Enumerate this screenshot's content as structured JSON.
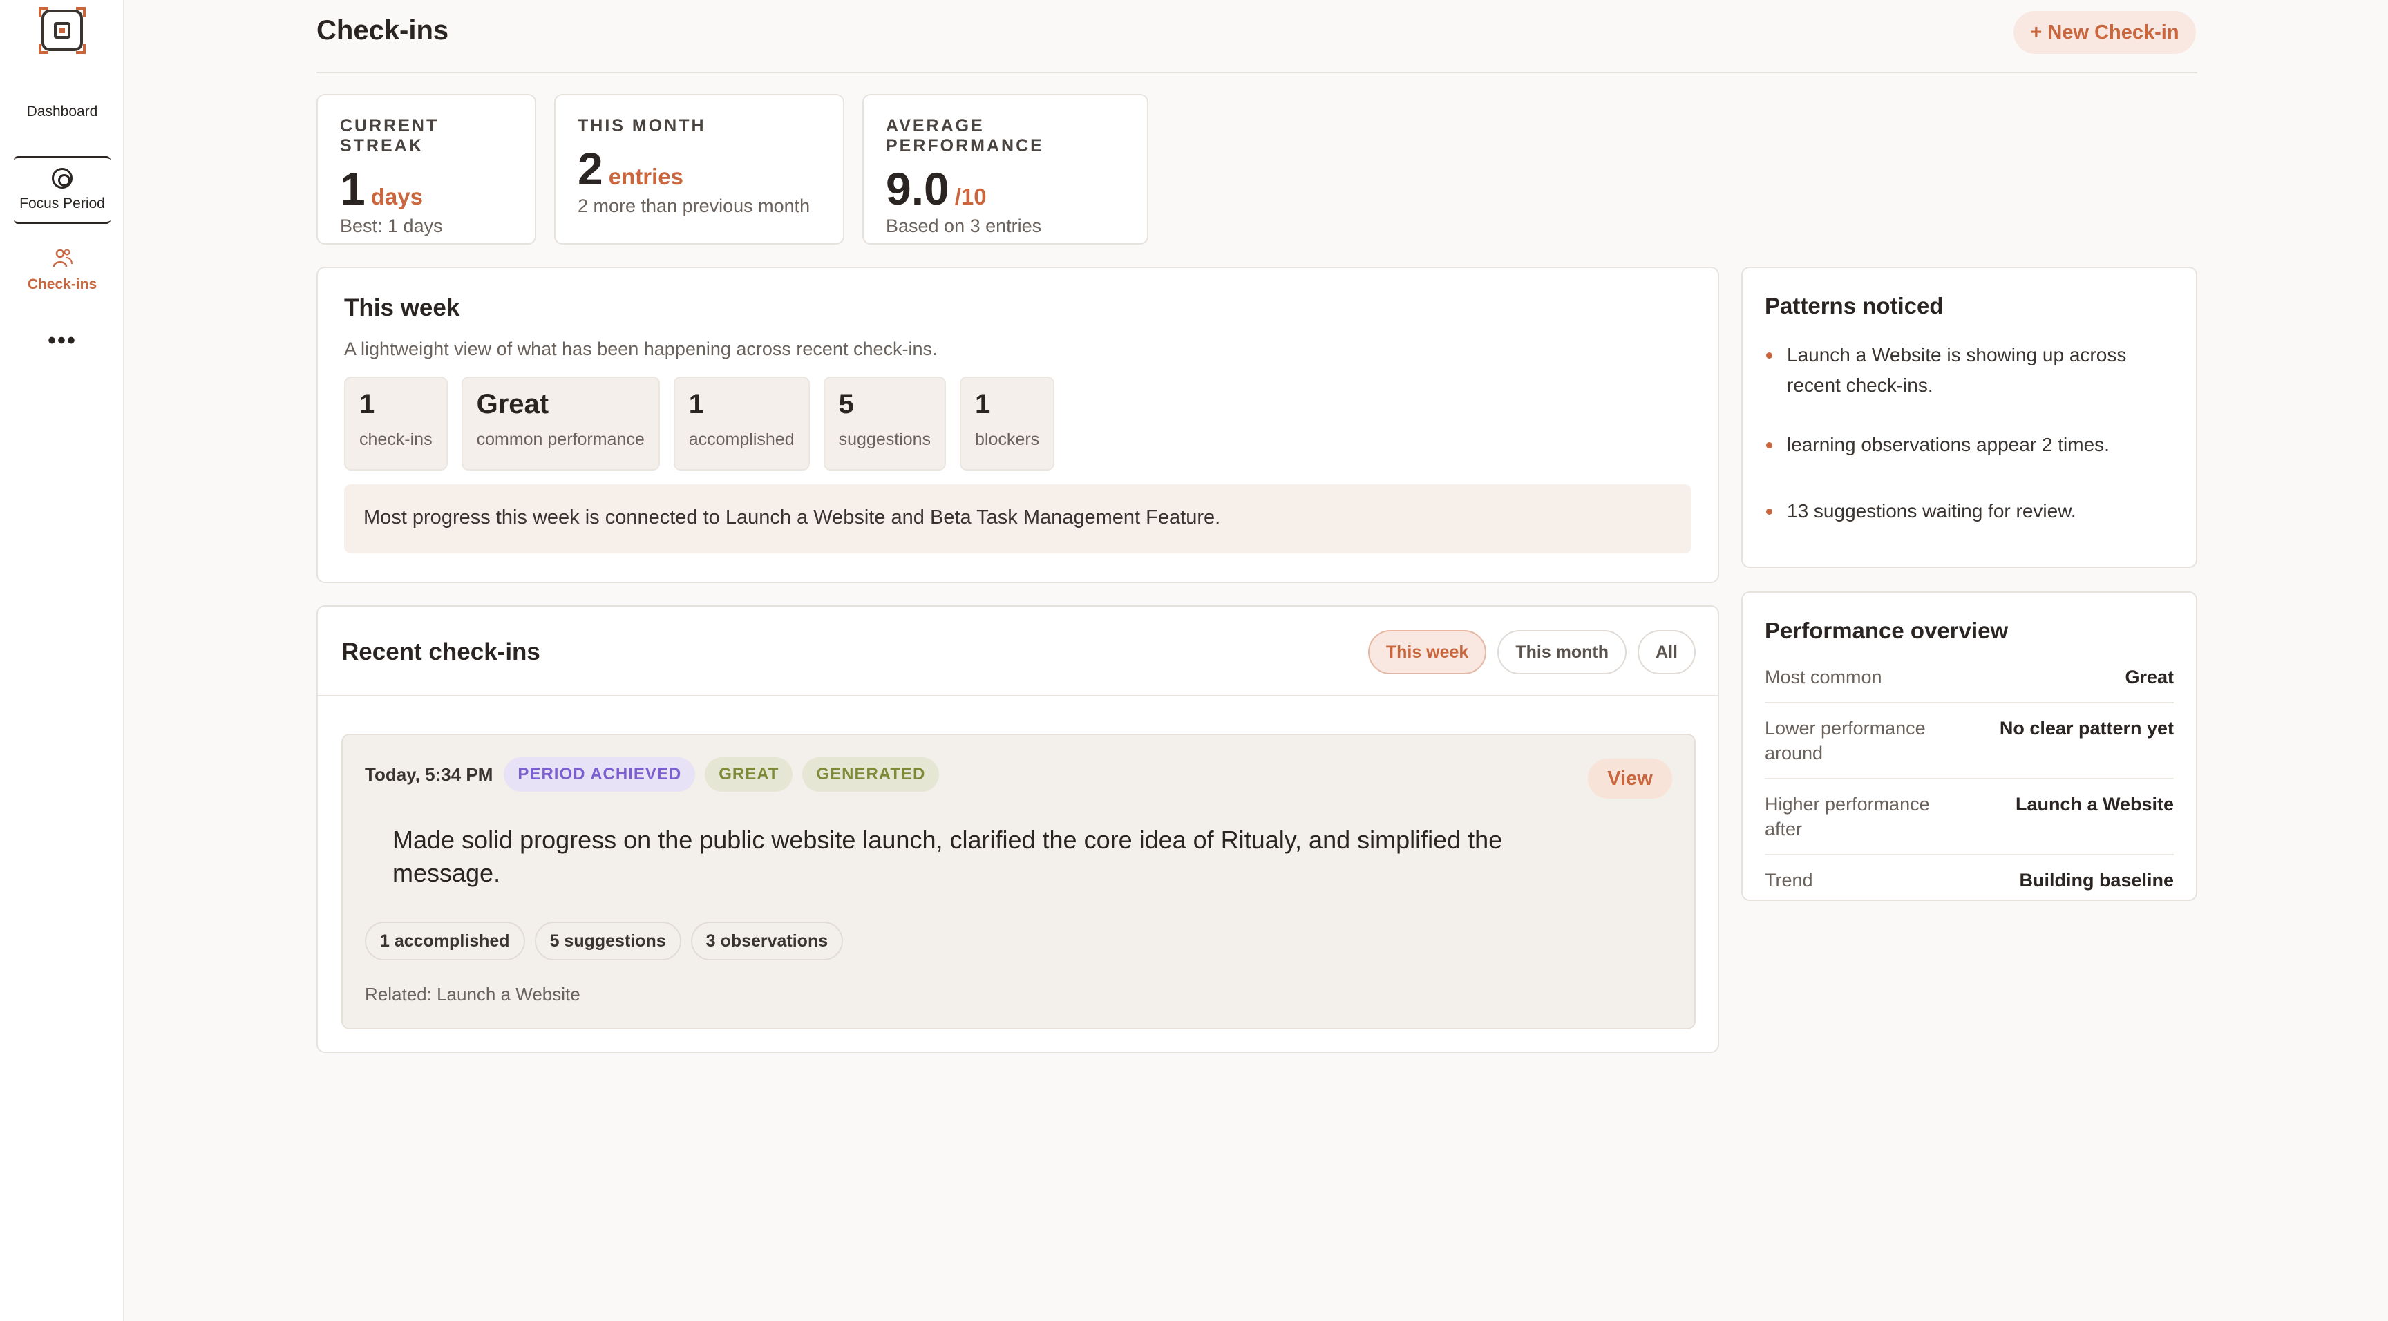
{
  "nav": {
    "dashboard": "Dashboard",
    "focus_period": "Focus Period",
    "checkins": "Check-ins",
    "more": "•••"
  },
  "header": {
    "title": "Check-ins",
    "new_button": "+ New Check-in"
  },
  "stats": {
    "streak": {
      "label": "CURRENT STREAK",
      "value": "1",
      "unit": "days",
      "sub": "Best: 1 days"
    },
    "month": {
      "label": "THIS MONTH",
      "value": "2",
      "unit": "entries",
      "sub": "2 more than previous month"
    },
    "performance": {
      "label": "AVERAGE PERFORMANCE",
      "value": "9.0",
      "unit": "/10",
      "sub": "Based on 3 entries"
    }
  },
  "week": {
    "title": "This week",
    "description": "A lightweight view of what has been happening across recent check-ins.",
    "chips": [
      {
        "value": "1",
        "label": "check-ins"
      },
      {
        "value": "Great",
        "label": "common performance"
      },
      {
        "value": "1",
        "label": "accomplished"
      },
      {
        "value": "5",
        "label": "suggestions"
      },
      {
        "value": "1",
        "label": "blockers"
      }
    ],
    "note": "Most progress this week is connected to Launch a Website and Beta Task Management Feature."
  },
  "recent": {
    "title": "Recent check-ins",
    "filters": [
      "This week",
      "This month",
      "All"
    ],
    "entry": {
      "time": "Today, 5:34 PM",
      "badges": [
        "PERIOD ACHIEVED",
        "GREAT",
        "GENERATED"
      ],
      "view": "View",
      "text": "Made solid progress on the public website launch, clarified the core idea of Ritualy, and simplified the message.",
      "pills": [
        "1 accomplished",
        "5 suggestions",
        "3 observations"
      ],
      "related": "Related: Launch a Website"
    }
  },
  "patterns": {
    "title": "Patterns noticed",
    "items": [
      "Launch a Website is showing up across recent check-ins.",
      "learning observations appear 2 times.",
      "13 suggestions waiting for review."
    ]
  },
  "performance": {
    "title": "Performance overview",
    "rows": [
      {
        "key": "Most common",
        "value": "Great"
      },
      {
        "key": "Lower performance around",
        "value": "No clear pattern yet"
      },
      {
        "key": "Higher performance after",
        "value": "Launch a Website"
      },
      {
        "key": "Trend",
        "value": "Building baseline"
      }
    ]
  },
  "colors": {
    "accent": "#c9663e",
    "purple_badge": "#7b5fd0",
    "green_badge": "#7f8a38"
  }
}
